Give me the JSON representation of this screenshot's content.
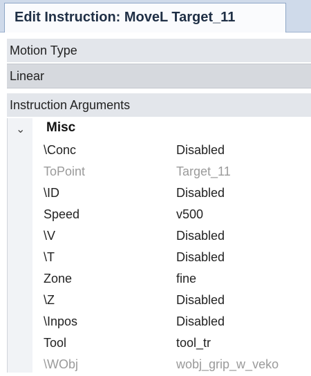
{
  "tab": {
    "title": "Edit Instruction: MoveL Target_11"
  },
  "motion_type": {
    "label": "Motion Type",
    "value": "Linear"
  },
  "instruction_arguments": {
    "label": "Instruction Arguments",
    "group": {
      "name": "Misc",
      "expanded": true,
      "icon": "chevron-down-icon"
    },
    "rows": [
      {
        "name": "\\Conc",
        "value": "Disabled",
        "enabled": true
      },
      {
        "name": "ToPoint",
        "value": "Target_11",
        "enabled": false
      },
      {
        "name": "\\ID",
        "value": "Disabled",
        "enabled": true
      },
      {
        "name": "Speed",
        "value": "v500",
        "enabled": true
      },
      {
        "name": "\\V",
        "value": "Disabled",
        "enabled": true
      },
      {
        "name": "\\T",
        "value": "Disabled",
        "enabled": true
      },
      {
        "name": "Zone",
        "value": "fine",
        "enabled": true
      },
      {
        "name": "\\Z",
        "value": "Disabled",
        "enabled": true
      },
      {
        "name": "\\Inpos",
        "value": "Disabled",
        "enabled": true
      },
      {
        "name": "Tool",
        "value": "tool_tr",
        "enabled": true
      },
      {
        "name": "\\WObj",
        "value": "wobj_grip_w_veko",
        "enabled": false
      }
    ]
  }
}
